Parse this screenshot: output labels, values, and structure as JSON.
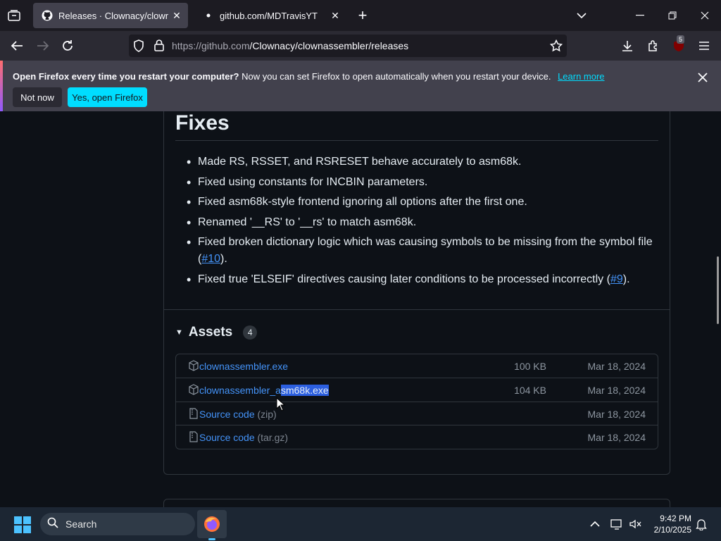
{
  "browser": {
    "tabs": [
      {
        "title": "Releases · Clownacy/clownasse",
        "active": true
      },
      {
        "title": "github.com/MDTravisYT",
        "active": false
      }
    ],
    "url": {
      "host": "https://github.com",
      "path": "/Clownacy/clownassembler/releases"
    },
    "extensions_badge": "5"
  },
  "notification": {
    "bold": "Open Firefox every time you restart your computer?",
    "message": "Now you can set Firefox to open automatically when you restart your device.",
    "learn_more": "Learn more",
    "not_now": "Not now",
    "yes": "Yes, open Firefox"
  },
  "release": {
    "fixes_title": "Fixes",
    "fixes": [
      {
        "text": "Made RS, RSSET, and RSRESET behave accurately to asm68k."
      },
      {
        "text": "Fixed using constants for INCBIN parameters."
      },
      {
        "text": "Fixed asm68k-style frontend ignoring all options after the first one."
      },
      {
        "text": "Renamed '__RS' to '__rs' to match asm68k."
      },
      {
        "text": "Fixed broken dictionary logic which was causing symbols to be missing from the symbol file (",
        "link": "#10",
        "after": ")."
      },
      {
        "text": "Fixed true 'ELSEIF' directives causing later conditions to be processed incorrectly (",
        "link": "#9",
        "after": ")."
      }
    ],
    "assets_title": "Assets",
    "assets_count": "4",
    "assets": [
      {
        "name": "clownassembler.exe",
        "size": "100 KB",
        "date": "Mar 18, 2024"
      },
      {
        "name_pre": "clownassembler_a",
        "name_sel": "sm68k.exe",
        "size": "104 KB",
        "date": "Mar 18, 2024"
      },
      {
        "name": "Source code",
        "ext": "(zip)",
        "size": "",
        "date": "Mar 18, 2024"
      },
      {
        "name": "Source code",
        "ext": "(tar.gz)",
        "size": "",
        "date": "Mar 18, 2024"
      }
    ]
  },
  "taskbar": {
    "search": "Search",
    "time": "9:42 PM",
    "date": "2/10/2025"
  },
  "colors": {
    "accent": "#00ddff",
    "link": "#4493f8",
    "page_bg": "#0d1117"
  }
}
